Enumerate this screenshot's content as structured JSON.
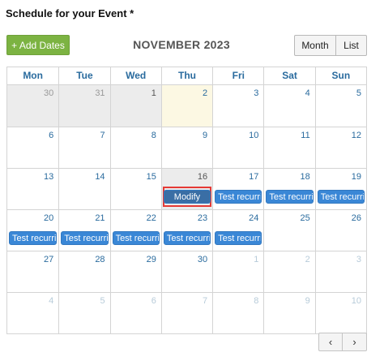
{
  "page": {
    "title": "Schedule for your Event *"
  },
  "toolbar": {
    "add_dates_label": "+ Add Dates",
    "month_title": "NOVEMBER 2023",
    "view_month_label": "Month",
    "view_list_label": "List"
  },
  "calendar": {
    "weekdays": [
      "Mon",
      "Tue",
      "Wed",
      "Thu",
      "Fri",
      "Sat",
      "Sun"
    ],
    "weeks": [
      [
        {
          "day": "30",
          "state": "other-past"
        },
        {
          "day": "31",
          "state": "other-past"
        },
        {
          "day": "1",
          "state": "past"
        },
        {
          "day": "2",
          "state": "today"
        },
        {
          "day": "3",
          "state": "current"
        },
        {
          "day": "4",
          "state": "current"
        },
        {
          "day": "5",
          "state": "current"
        }
      ],
      [
        {
          "day": "6",
          "state": "current"
        },
        {
          "day": "7",
          "state": "current"
        },
        {
          "day": "8",
          "state": "current"
        },
        {
          "day": "9",
          "state": "current"
        },
        {
          "day": "10",
          "state": "current"
        },
        {
          "day": "11",
          "state": "current"
        },
        {
          "day": "12",
          "state": "current"
        }
      ],
      [
        {
          "day": "13",
          "state": "current"
        },
        {
          "day": "14",
          "state": "current"
        },
        {
          "day": "15",
          "state": "current"
        },
        {
          "day": "16",
          "state": "past-event",
          "event": "Modify",
          "event_kind": "modify",
          "highlighted": true
        },
        {
          "day": "17",
          "state": "current",
          "event": "Test recurring event"
        },
        {
          "day": "18",
          "state": "current",
          "event": "Test recurring event"
        },
        {
          "day": "19",
          "state": "current",
          "event": "Test recurring event"
        }
      ],
      [
        {
          "day": "20",
          "state": "current",
          "event": "Test recurring event"
        },
        {
          "day": "21",
          "state": "current",
          "event": "Test recurring event"
        },
        {
          "day": "22",
          "state": "current",
          "event": "Test recurring event"
        },
        {
          "day": "23",
          "state": "current",
          "event": "Test recurring event"
        },
        {
          "day": "24",
          "state": "current",
          "event": "Test recurring event"
        },
        {
          "day": "25",
          "state": "current"
        },
        {
          "day": "26",
          "state": "current"
        }
      ],
      [
        {
          "day": "27",
          "state": "current"
        },
        {
          "day": "28",
          "state": "current"
        },
        {
          "day": "29",
          "state": "current"
        },
        {
          "day": "30",
          "state": "current"
        },
        {
          "day": "1",
          "state": "other"
        },
        {
          "day": "2",
          "state": "other"
        },
        {
          "day": "3",
          "state": "other"
        }
      ],
      [
        {
          "day": "4",
          "state": "other"
        },
        {
          "day": "5",
          "state": "other"
        },
        {
          "day": "6",
          "state": "other"
        },
        {
          "day": "7",
          "state": "other"
        },
        {
          "day": "8",
          "state": "other"
        },
        {
          "day": "9",
          "state": "other"
        },
        {
          "day": "10",
          "state": "other"
        }
      ]
    ]
  },
  "pager": {
    "prev_icon": "chevron-left-icon",
    "next_icon": "chevron-right-icon",
    "prev_glyph": "‹",
    "next_glyph": "›"
  },
  "colors": {
    "add_button": "#7cb342",
    "event": "#3a87d6",
    "modify_event": "#3a6ea5",
    "today": "#fcf8e3",
    "past": "#ececec",
    "highlight": "#e53935",
    "day_number": "#2a6b9e"
  }
}
